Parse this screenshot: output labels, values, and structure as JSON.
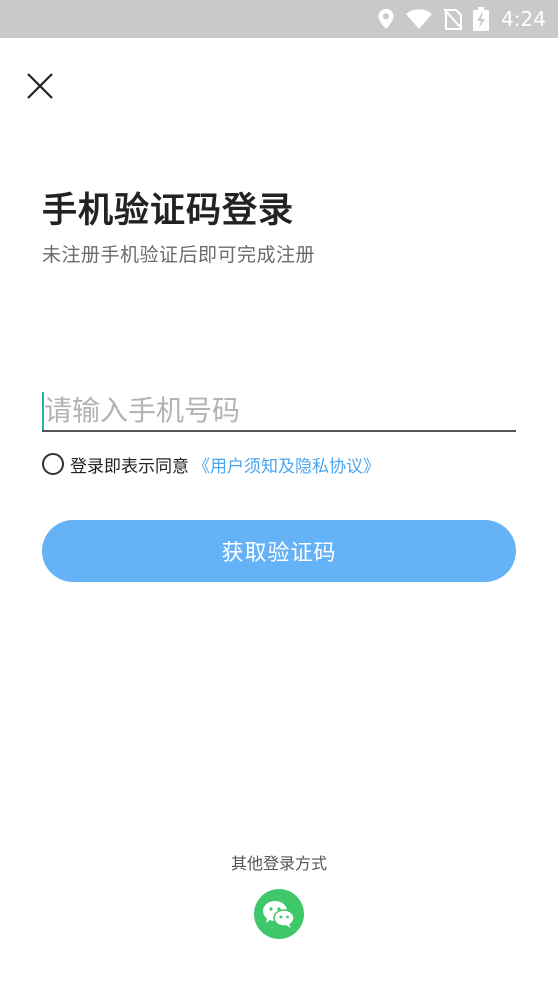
{
  "status_bar": {
    "time": "4:24",
    "icons": [
      "location-icon",
      "wifi-icon",
      "no-sim-icon",
      "battery-charging-icon"
    ]
  },
  "header": {
    "close_icon": "close-icon"
  },
  "title": "手机验证码登录",
  "subtitle": "未注册手机验证后即可完成注册",
  "phone_input": {
    "placeholder": "请输入手机号码",
    "value": ""
  },
  "agreement": {
    "checked": false,
    "text": "登录即表示同意",
    "link_text": "《用户须知及隐私协议》"
  },
  "primary_button": {
    "label": "获取验证码"
  },
  "other_login": {
    "label": "其他登录方式",
    "options": [
      "wechat-icon"
    ]
  },
  "colors": {
    "accent_blue": "#65b2f7",
    "link_blue": "#4aa5f0",
    "wechat_green": "#3fc86a",
    "status_bar_bg": "#c9c9c9",
    "caret": "#20b2aa"
  }
}
